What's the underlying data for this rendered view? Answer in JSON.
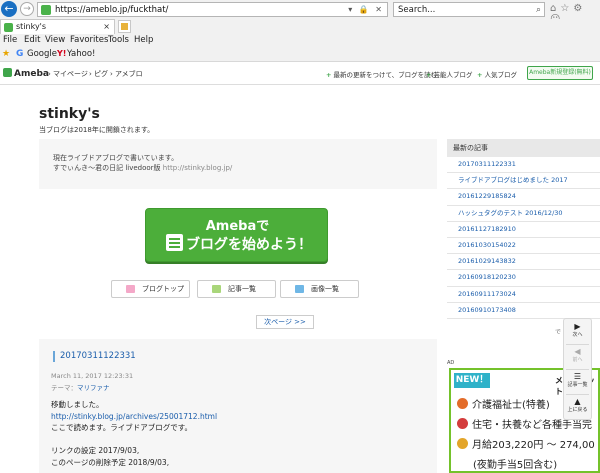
{
  "browser": {
    "url": "https://ameblo.jp/fuckthat/",
    "search_placeholder": "Search...",
    "tab_title": "stinky's",
    "menu": [
      "File",
      "Edit",
      "View",
      "Favorites",
      "Tools",
      "Help"
    ],
    "favorites": [
      "Google",
      "Yahoo!"
    ]
  },
  "header": {
    "logo": "Ameba",
    "links": [
      "マイページ",
      "ピグ",
      "アメブロ"
    ],
    "right_links": [
      "最新の更新をつけて、ブログを読む",
      "芸能人ブログ",
      "人気ブログ"
    ],
    "signup": "Ameba新規登録(無料)"
  },
  "blog": {
    "title": "stinky's",
    "description": "当ブログは2018年に開鎖されます。",
    "profile_line1": "現在ライブドアブログで書いています。",
    "profile_line2": "すでぃんき〜君の日記",
    "profile_line2_source": "livedoor版",
    "profile_line2_url": "http://stinky.blog.jp/"
  },
  "cta": {
    "line1": "Amebaで",
    "line2": "ブログを始めよう！"
  },
  "sub_buttons": [
    "ブログトップ",
    "記事一覧",
    "画像一覧"
  ],
  "next_page": "次ページ >>",
  "entry": {
    "title": "20170311122331",
    "date": "March 11, 2017 12:23:31",
    "theme_label": "テーマ：",
    "theme": "マリファナ",
    "body": [
      "移動しました。",
      "http://stinky.blog.jp/archives/25001712.html",
      "ここで読めます。ライブドアブログです。",
      "",
      "リンクの設定 2017/9/03,",
      "このページの削除予定 2018/9/03,"
    ]
  },
  "sidebar": {
    "heading": "最新の記事",
    "items": [
      "20170311122331",
      "ライブドアブログはじめました 2017",
      "20161229185824",
      "ハッシュタグのテスト 2016/12/30",
      "20161127182910",
      "20161030154022",
      "20161029143832",
      "20160918120230",
      "20160911173024",
      "20160910173408"
    ]
  },
  "ad": {
    "label": "AD",
    "badge": "NEW！",
    "brand": "メドフィット",
    "line1": "介護福祉士(特養)",
    "line2": "住宅・扶養など各種手当完",
    "line3": "月給203,220円 〜 274,00",
    "line4": "(夜勤手当5回含む)"
  },
  "scroll_widget": {
    "next": "次へ",
    "prev": "前へ",
    "list": "記事一覧",
    "top": "上に戻る"
  },
  "side_badge": "で へ"
}
